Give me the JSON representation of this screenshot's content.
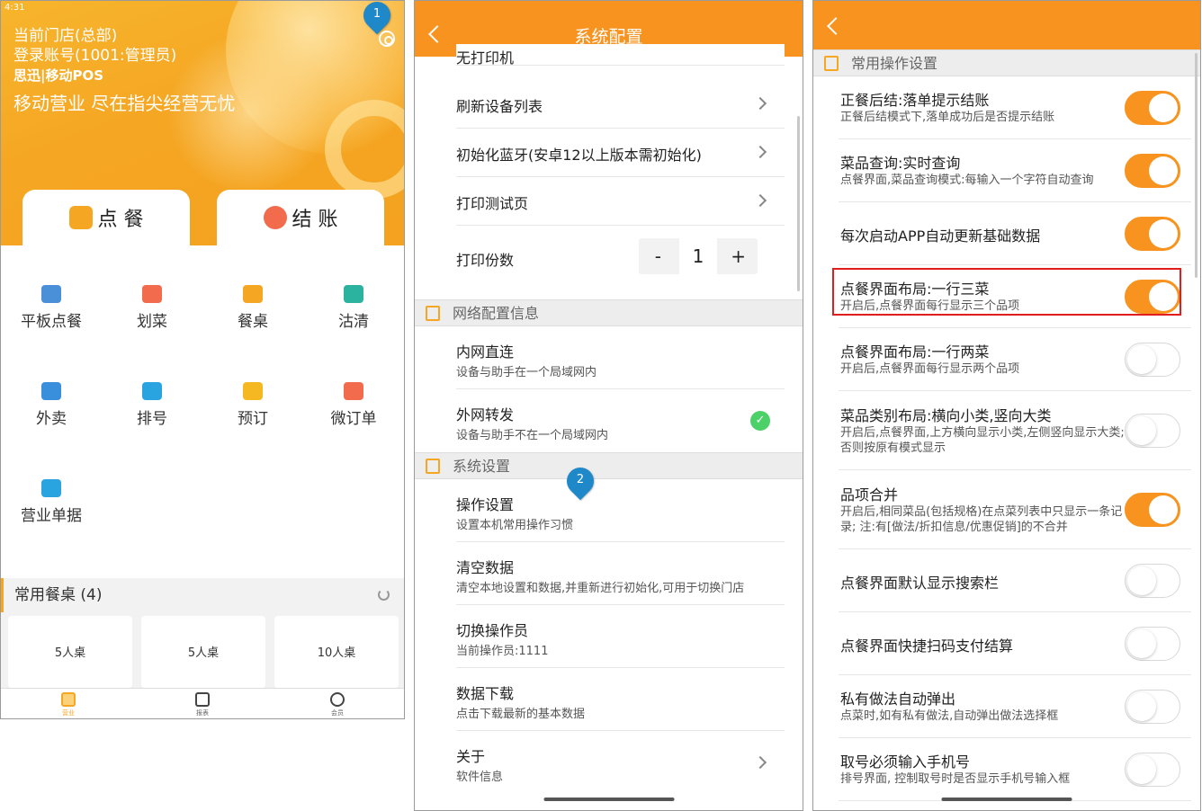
{
  "colors": {
    "accent": "#f7931e",
    "highlight": "#e01e1e",
    "pin": "#1e88c8",
    "check": "#4cd168"
  },
  "annotations": {
    "pin1": "1",
    "pin2": "2"
  },
  "screen1": {
    "status_time": "4:31",
    "store": "当前门店(总部)",
    "account": "登录账号(1001:管理员)",
    "brand": "思迅|移动POS",
    "slogan": "移动营业 尽在指尖经营无忧",
    "tab_order": "点 餐",
    "tab_checkout": "结 账",
    "grid": [
      {
        "label": "平板点餐",
        "icon": "tablet-icon",
        "color": "#4a90d9"
      },
      {
        "label": "划菜",
        "icon": "bell-icon",
        "color": "#f26b4c"
      },
      {
        "label": "餐桌",
        "icon": "table-icon",
        "color": "#f5a623"
      },
      {
        "label": "沽清",
        "icon": "cloche-icon",
        "color": "#2bb3a0"
      },
      {
        "label": "外卖",
        "icon": "scooter-icon",
        "color": "#3a8fdc"
      },
      {
        "label": "排号",
        "icon": "ticket-icon",
        "color": "#2aa4e0"
      },
      {
        "label": "预订",
        "icon": "clock-icon",
        "color": "#f5b823"
      },
      {
        "label": "微订单",
        "icon": "document-icon",
        "color": "#f26b4c"
      },
      {
        "label": "营业单据",
        "icon": "chart-icon",
        "color": "#2aa4e0"
      }
    ],
    "common_tables_title": "常用餐桌 (4)",
    "tables": [
      "5人桌",
      "5人桌",
      "10人桌"
    ],
    "nav": [
      "营业",
      "报表",
      "会员"
    ]
  },
  "screen2": {
    "title": "系统配置",
    "partial_row": "无打印机",
    "rows_top": [
      {
        "title": "刷新设备列表"
      },
      {
        "title": "初始化蓝牙(安卓12以上版本需初始化)"
      },
      {
        "title": "打印测试页"
      }
    ],
    "print_copies_label": "打印份数",
    "stepper": {
      "minus": "-",
      "value": "1",
      "plus": "+"
    },
    "section_network": "网络配置信息",
    "network": [
      {
        "title": "内网直连",
        "sub": "设备与助手在一个局域网内"
      },
      {
        "title": "外网转发",
        "sub": "设备与助手不在一个局域网内",
        "check": "✓"
      }
    ],
    "section_system": "系统设置",
    "system": [
      {
        "title": "操作设置",
        "sub": "设置本机常用操作习惯"
      },
      {
        "title": "清空数据",
        "sub": "清空本地设置和数据,并重新进行初始化,可用于切换门店"
      },
      {
        "title": "切换操作员",
        "sub": "当前操作员:1111"
      },
      {
        "title": "数据下载",
        "sub": "点击下载最新的基本数据"
      },
      {
        "title": "关于",
        "sub": "软件信息"
      }
    ]
  },
  "screen3": {
    "section": "常用操作设置",
    "toggles": [
      {
        "title": "正餐后结:落单提示结账",
        "sub": "正餐后结模式下,落单成功后是否提示结账",
        "on": true
      },
      {
        "title": "菜品查询:实时查询",
        "sub": "点餐界面,菜品查询模式:每输入一个字符自动查询",
        "on": true
      },
      {
        "title": "每次启动APP自动更新基础数据",
        "sub": "",
        "on": true
      },
      {
        "title": "点餐界面布局:一行三菜",
        "sub": "开启后,点餐界面每行显示三个品项",
        "on": true
      },
      {
        "title": "点餐界面布局:一行两菜",
        "sub": "开启后,点餐界面每行显示两个品项",
        "on": false
      },
      {
        "title": "菜品类别布局:横向小类,竖向大类",
        "sub": "开启后,点餐界面,上方横向显示小类,左侧竖向显示大类;否则按原有模式显示",
        "on": false
      },
      {
        "title": "品项合并",
        "sub": "开启后,相同菜品(包括规格)在点菜列表中只显示一条记录; 注:有[做法/折扣信息/优惠促销]的不合并",
        "on": true
      },
      {
        "title": "点餐界面默认显示搜索栏",
        "sub": "",
        "on": false
      },
      {
        "title": "点餐界面快捷扫码支付结算",
        "sub": "",
        "on": false
      },
      {
        "title": "私有做法自动弹出",
        "sub": "点菜时,如有私有做法,自动弹出做法选择框",
        "on": false
      },
      {
        "title": "取号必须输入手机号",
        "sub": "排号界面, 控制取号时是否显示手机号输入框",
        "on": false
      }
    ]
  }
}
